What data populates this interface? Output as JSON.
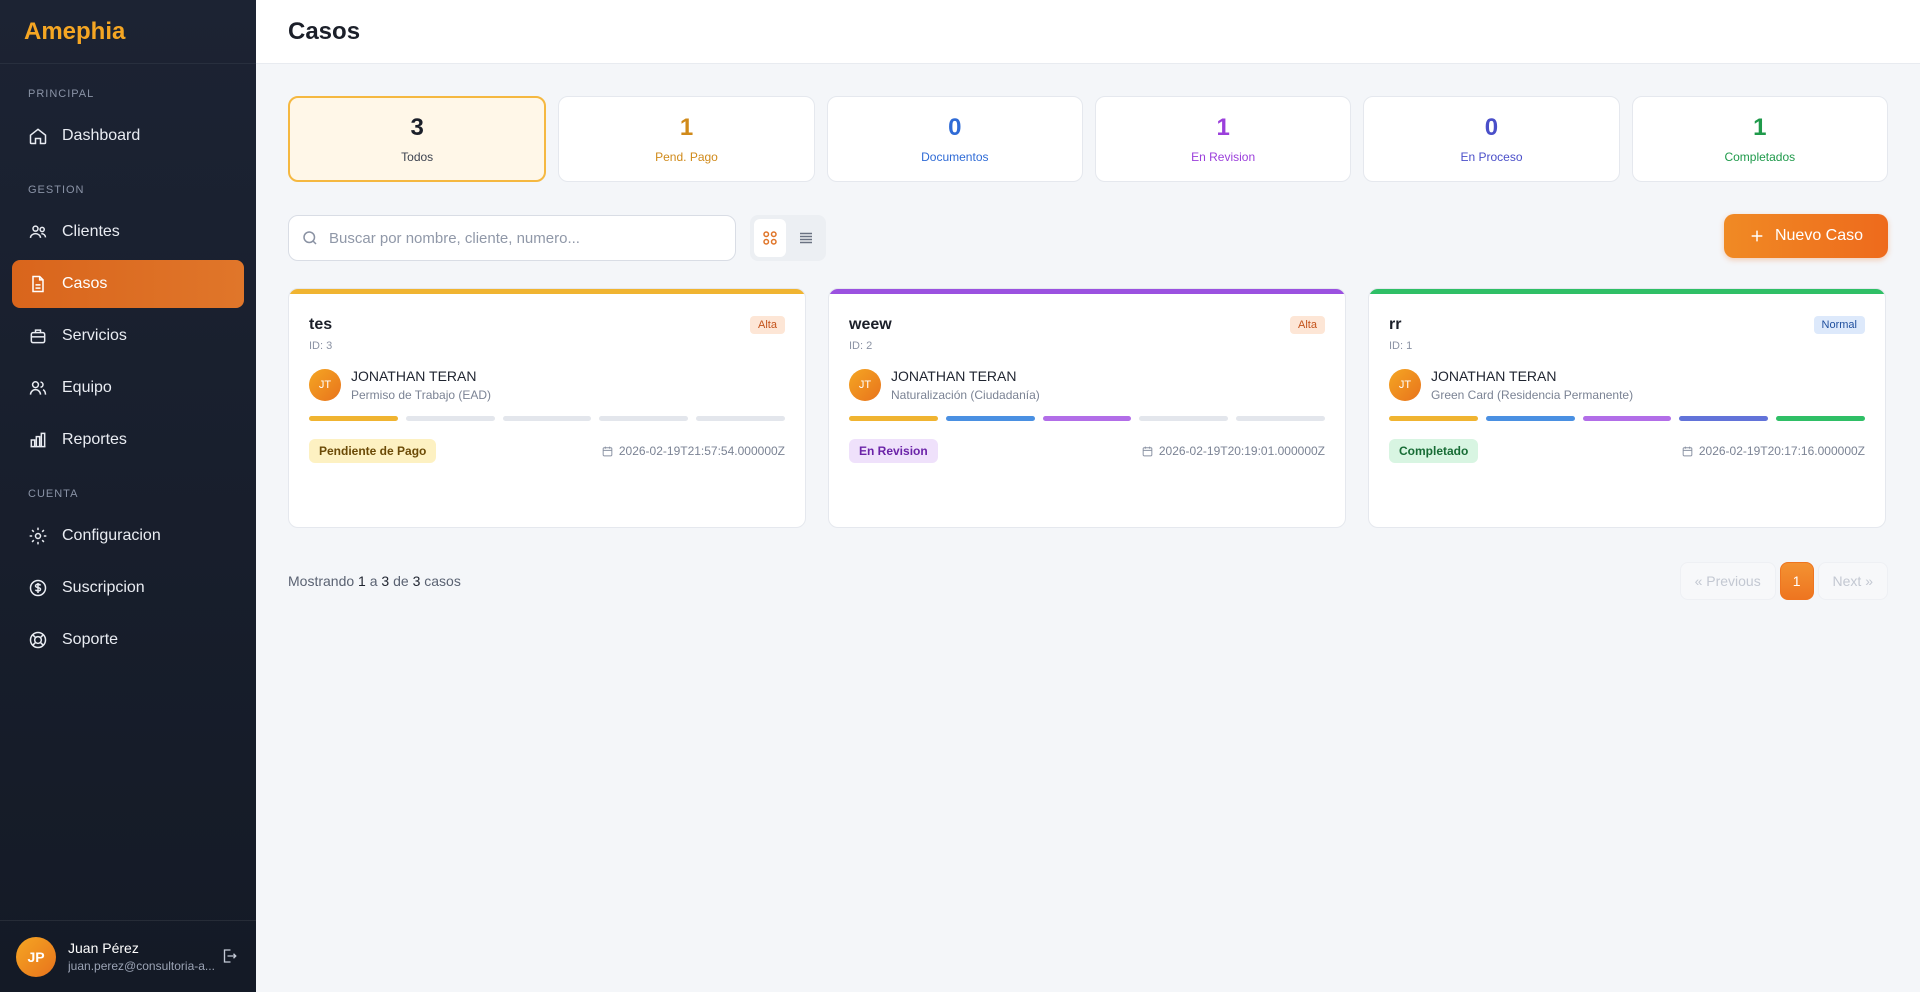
{
  "app": {
    "brand": "Amephia"
  },
  "sidebar": {
    "sections": [
      {
        "label": "PRINCIPAL",
        "items": [
          {
            "label": "Dashboard",
            "icon": "home-icon"
          }
        ]
      },
      {
        "label": "GESTION",
        "items": [
          {
            "label": "Clientes",
            "icon": "users-icon"
          },
          {
            "label": "Casos",
            "icon": "document-icon",
            "active": true
          },
          {
            "label": "Servicios",
            "icon": "briefcase-icon"
          },
          {
            "label": "Equipo",
            "icon": "team-icon"
          },
          {
            "label": "Reportes",
            "icon": "bar-chart-icon"
          }
        ]
      },
      {
        "label": "CUENTA",
        "items": [
          {
            "label": "Configuracion",
            "icon": "gear-icon"
          },
          {
            "label": "Suscripcion",
            "icon": "dollar-circle-icon"
          },
          {
            "label": "Soporte",
            "icon": "lifebuoy-icon"
          }
        ]
      }
    ],
    "user": {
      "initials": "JP",
      "name": "Juan Pérez",
      "email": "juan.perez@consultoria-a..."
    }
  },
  "header": {
    "title": "Casos"
  },
  "stats": [
    {
      "value": "3",
      "label": "Todos",
      "color": "#1b1f29",
      "active": true
    },
    {
      "value": "1",
      "label": "Pend. Pago",
      "color": "#d08a1a"
    },
    {
      "value": "0",
      "label": "Documentos",
      "color": "#2f6bd6"
    },
    {
      "value": "1",
      "label": "En Revision",
      "color": "#9b3fdb"
    },
    {
      "value": "0",
      "label": "En Proceso",
      "color": "#4a4fc9"
    },
    {
      "value": "1",
      "label": "Completados",
      "color": "#1f9a4b"
    }
  ],
  "toolbar": {
    "search_placeholder": "Buscar por nombre, cliente, numero...",
    "new_case_label": "Nuevo Caso"
  },
  "cases": [
    {
      "title": "tes",
      "id": "ID: 3",
      "priority": "Alta",
      "priority_style": "alta",
      "bar_color": "#f0b431",
      "client_initials": "JT",
      "client_name": "JONATHAN TERAN",
      "service": "Permiso de Trabajo (EAD)",
      "progress_steps_done": 1,
      "status": "Pendiente de Pago",
      "status_style": "pend",
      "date": "2026-02-19T21:57:54.000000Z"
    },
    {
      "title": "weew",
      "id": "ID: 2",
      "priority": "Alta",
      "priority_style": "alta",
      "bar_color": "#9b51e0",
      "client_initials": "JT",
      "client_name": "JONATHAN TERAN",
      "service": "Naturalización (Ciudadanía)",
      "progress_steps_done": 3,
      "status": "En Revision",
      "status_style": "rev",
      "date": "2026-02-19T20:19:01.000000Z"
    },
    {
      "title": "rr",
      "id": "ID: 1",
      "priority": "Normal",
      "priority_style": "normal",
      "bar_color": "#2fbf66",
      "client_initials": "JT",
      "client_name": "JONATHAN TERAN",
      "service": "Green Card (Residencia Permanente)",
      "progress_steps_done": 5,
      "status": "Completado",
      "status_style": "done",
      "date": "2026-02-19T20:17:16.000000Z"
    }
  ],
  "progress_colors": [
    "#f0b431",
    "#4a90e2",
    "#b26ee8",
    "#6273d9",
    "#2fbf66"
  ],
  "pagination": {
    "showing_prefix": "Mostrando",
    "from": "1",
    "a": "a",
    "to": "3",
    "de": "de",
    "total": "3",
    "suffix": "casos",
    "previous": "« Previous",
    "current": "1",
    "next": "Next »"
  }
}
